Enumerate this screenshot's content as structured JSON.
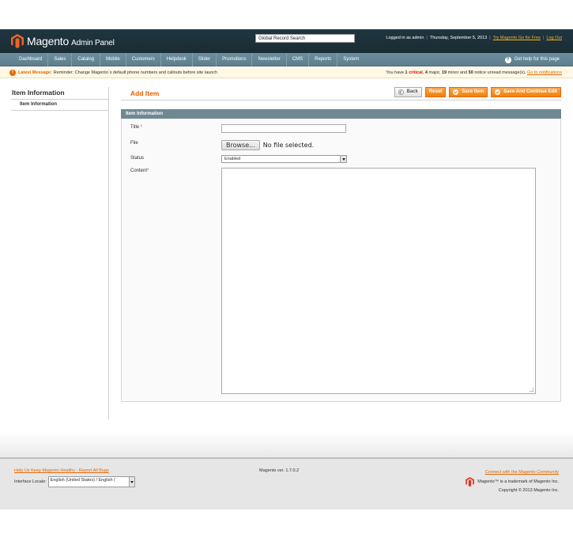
{
  "header": {
    "logo_text": "Magento",
    "logo_sub": "Admin Panel",
    "search_value": "Global Record Search",
    "logged_in": "Logged in as admin",
    "date": "Thursday, September 5, 2013",
    "try_link": "Try Magento Go for Free",
    "logout_link": "Log Out"
  },
  "nav": {
    "items": [
      "Dashboard",
      "Sales",
      "Catalog",
      "Mobile",
      "Customers",
      "Helpdesk",
      "Slider",
      "Promotions",
      "Newsletter",
      "CMS",
      "Reports",
      "System"
    ],
    "help": "Get help for this page"
  },
  "notice": {
    "label": "Latest Message:",
    "message": "Reminder: Change Magento`s default phone numbers and callouts before site launch",
    "right_prefix": "You have",
    "critical_count": "1",
    "critical_word": "critical",
    "major_count": "4",
    "major_text": "major,",
    "minor_count": "19",
    "minor_text": "minor and",
    "notice_count": "50",
    "notice_text": "notice unread message(s).",
    "notifications_link": "Go to notifications"
  },
  "sidebar": {
    "title": "Item Information",
    "tab": "Item Information"
  },
  "content": {
    "title": "Add Item",
    "buttons": {
      "back": "Back",
      "reset": "Reset",
      "save": "Save Item",
      "save_continue": "Save And Continue Edit"
    },
    "fieldset_title": "Item Information",
    "fields": {
      "title_label": "Title",
      "file_label": "File",
      "browse": "Browse...",
      "file_status": "No file selected.",
      "status_label": "Status",
      "status_value": "Enabled",
      "content_label": "Content",
      "required_mark": "*"
    }
  },
  "footer": {
    "bug_link": "Help Us Keep Magento Healthy - Report All Bugs",
    "locale_label": "Interface Locale:",
    "locale_value": "English (United States) / English (",
    "version": "Magento ver. 1.7.0.2",
    "community_link": "Connect with the Magento Community",
    "trademark": "Magento™ is a trademark of Magento Inc.",
    "copyright": "Copyright © 2013 Magento Inc."
  },
  "colors": {
    "accent": "#eb5e00",
    "header_bg": "#1f3640",
    "nav_bg": "#6b8e9e",
    "fieldset_head": "#6f8992"
  }
}
